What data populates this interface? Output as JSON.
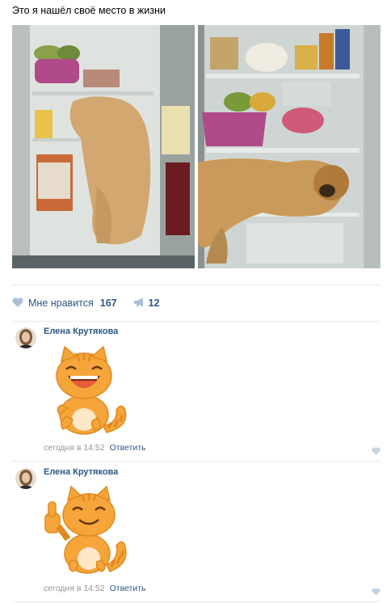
{
  "post": {
    "text": "Это я нашёл своё место в жизни"
  },
  "actions": {
    "like_label": "Мне нравится",
    "like_count": "167",
    "share_count": "12"
  },
  "comments": [
    {
      "author": "Елена Крутякова",
      "time": "сегодня в 14:52",
      "reply_label": "Ответить",
      "sticker": "laughing-cat-sticker"
    },
    {
      "author": "Елена Крутякова",
      "time": "сегодня в 14:52",
      "reply_label": "Ответить",
      "sticker": "thumbs-up-cat-sticker"
    }
  ],
  "colors": {
    "link": "#2a5885",
    "muted": "#939393",
    "divider": "#e7e8ec",
    "icon": "#a8bfd6",
    "cat_orange": "#f5a53a"
  }
}
